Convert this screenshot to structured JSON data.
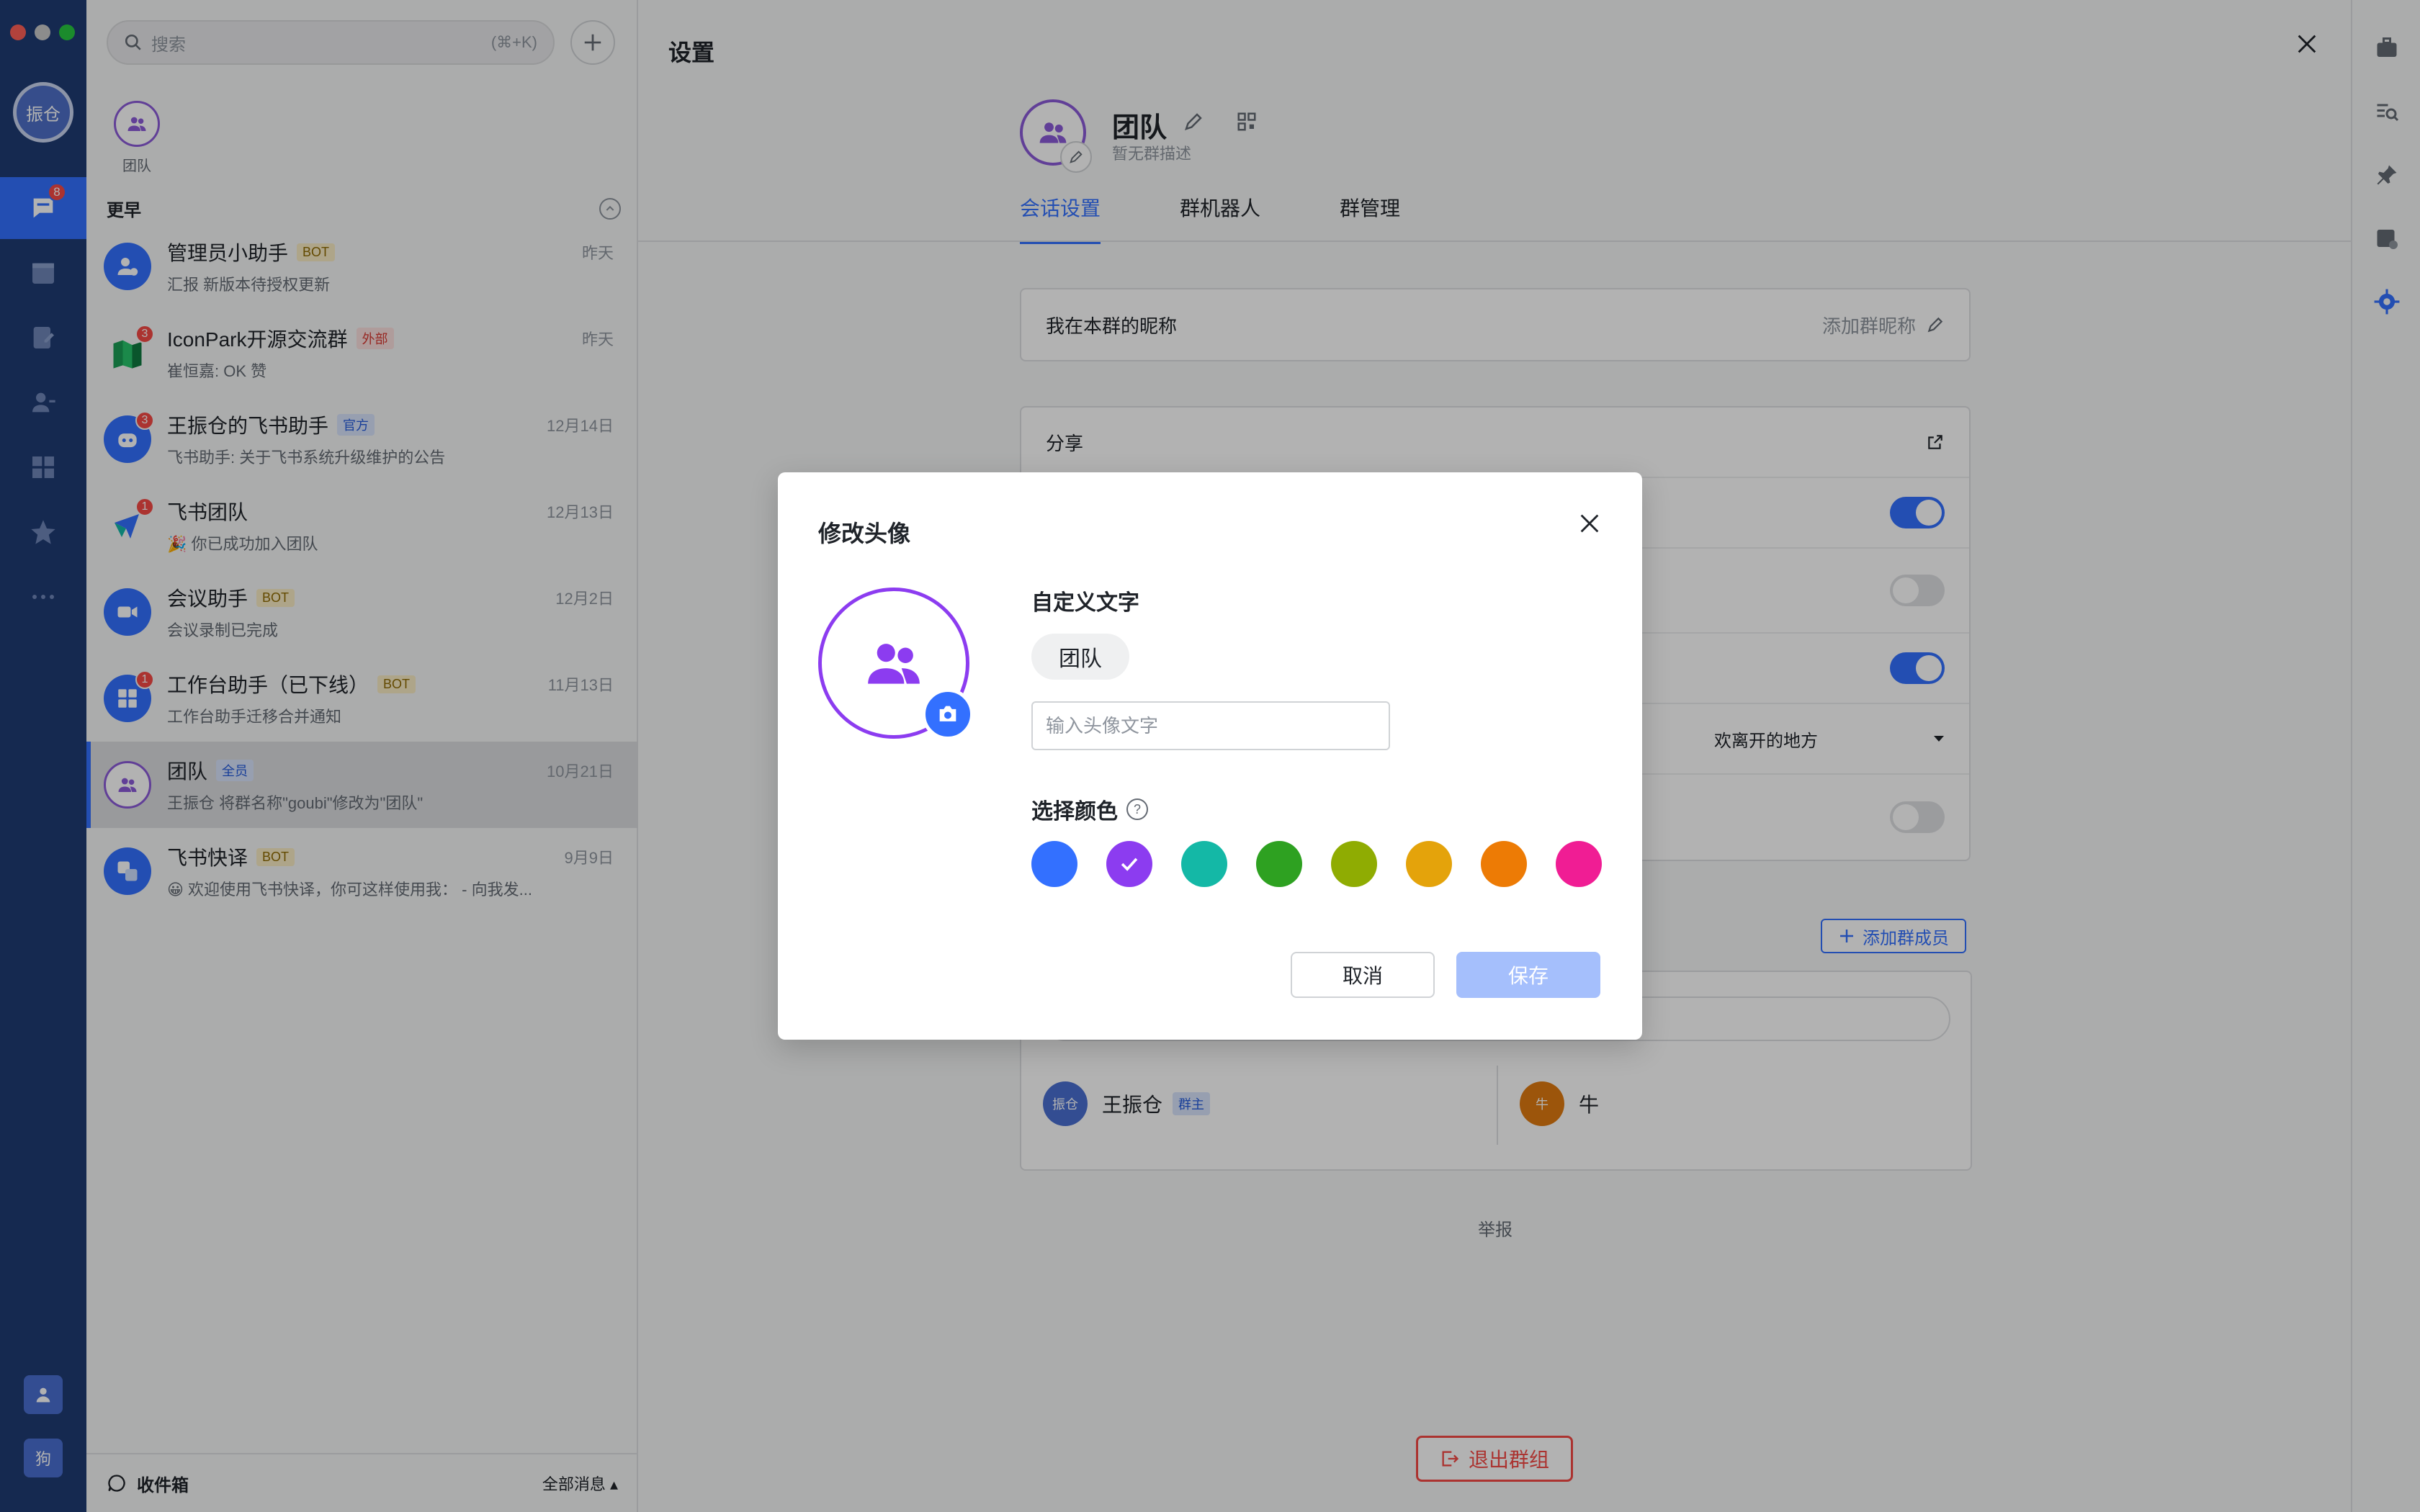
{
  "rail": {
    "user_initials": "振仓",
    "chat_badge": "8",
    "bottom_avatar_text": "狗"
  },
  "chatlist": {
    "search_placeholder": "搜索",
    "search_shortcut": "(⌘+K)",
    "pinned_label": "团队",
    "section_title": "更早",
    "chats": [
      {
        "name": "管理员小助手",
        "tag": "BOT",
        "tag_kind": "bot",
        "time": "昨天",
        "preview": "汇报 新版本待授权更新",
        "badge": "",
        "avatar_color": "#3370ff"
      },
      {
        "name": "IconPark开源交流群",
        "tag": "外部",
        "tag_kind": "ext",
        "time": "昨天",
        "preview": "崔恒嘉: OK 赞",
        "badge": "3",
        "avatar_color": "#f5f6f7"
      },
      {
        "name": "王振仓的飞书助手",
        "tag": "官方",
        "tag_kind": "off",
        "time": "12月14日",
        "preview": "飞书助手: 关于飞书系统升级维护的公告",
        "badge": "3",
        "avatar_color": "#3370ff"
      },
      {
        "name": "飞书团队",
        "tag": "",
        "tag_kind": "",
        "time": "12月13日",
        "preview": "🎉 你已成功加入团队",
        "badge": "1",
        "avatar_color": "#f5f6f7"
      },
      {
        "name": "会议助手",
        "tag": "BOT",
        "tag_kind": "bot",
        "time": "12月2日",
        "preview": "会议录制已完成",
        "badge": "",
        "avatar_color": "#3370ff"
      },
      {
        "name": "工作台助手（已下线）",
        "tag": "BOT",
        "tag_kind": "bot",
        "time": "11月13日",
        "preview": "工作台助手迁移合并通知",
        "badge": "1",
        "avatar_color": "#3370ff"
      },
      {
        "name": "团队",
        "tag": "全员",
        "tag_kind": "off",
        "time": "10月21日",
        "preview": "王振仓 将群名称\"goubi\"修改为\"团队\"",
        "badge": "",
        "avatar_color": "#ffffff"
      },
      {
        "name": "飞书快译",
        "tag": "BOT",
        "tag_kind": "bot",
        "time": "9月9日",
        "preview": "😀 欢迎使用飞书快译，你可这样使用我： - 向我发...",
        "badge": "",
        "avatar_color": "#3370ff"
      }
    ],
    "inbox_label": "收件箱",
    "inbox_filter": "全部消息 ▴"
  },
  "settings": {
    "title": "设置",
    "group_name": "团队",
    "group_desc": "暂无群描述",
    "tabs": [
      "会话设置",
      "群机器人",
      "群管理"
    ],
    "nickname_label": "我在本群的昵称",
    "nickname_placeholder": "添加群昵称",
    "share_label": "分享",
    "select_value": "欢离开的地方",
    "add_member_label": "添加群成员",
    "members": [
      {
        "name": "王振仓",
        "initials": "振仓",
        "tag": "群主",
        "color": "#4a6fd1"
      },
      {
        "name": "牛",
        "initials": "牛",
        "tag": "",
        "color": "#e07a10"
      }
    ],
    "report_label": "举报",
    "exit_label": "退出群组"
  },
  "modal": {
    "title": "修改头像",
    "custom_text_label": "自定义文字",
    "current_text": "团队",
    "input_placeholder": "输入头像文字",
    "color_label": "选择颜色",
    "help_glyph": "?",
    "colors": [
      "#3370ff",
      "#8c3cf0",
      "#14b8a6",
      "#2ea121",
      "#8fac02",
      "#e4a30b",
      "#ed7b05",
      "#f01d94"
    ],
    "selected_color_index": 1,
    "cancel_label": "取消",
    "save_label": "保存"
  }
}
